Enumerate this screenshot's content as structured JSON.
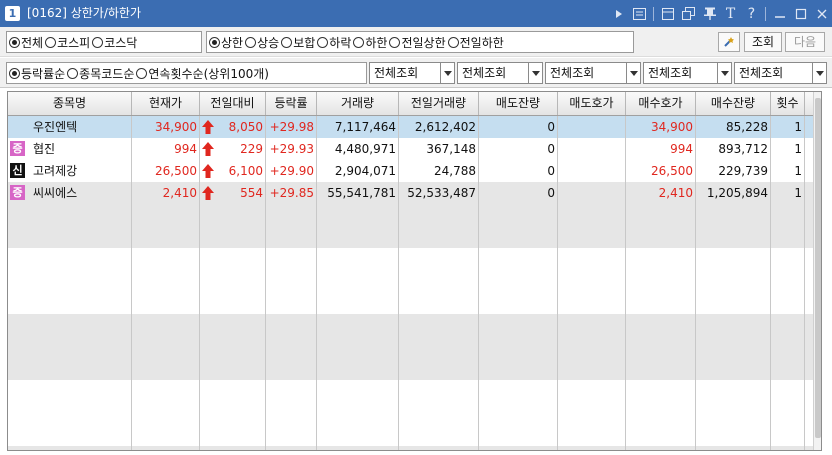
{
  "window": {
    "number": "1",
    "title": "[0162] 상한가/하한가"
  },
  "titlebar_icons": [
    "play-icon",
    "memo-icon",
    "window-icon",
    "popout-icon",
    "pin-icon",
    "font-size-icon",
    "help-icon",
    "minimize-icon",
    "maximize-icon",
    "close-icon"
  ],
  "titlebar_text": {
    "font": "T",
    "help": "?"
  },
  "market_filter": {
    "options": [
      "전체",
      "코스피",
      "코스닥"
    ],
    "selected": "전체"
  },
  "limit_filter": {
    "options": [
      "상한",
      "상승",
      "보합",
      "하락",
      "하한",
      "전일상한",
      "전일하한"
    ],
    "selected": "상한"
  },
  "actions": {
    "search": "조회",
    "next": "다음"
  },
  "sort_filter": {
    "options": [
      "등락률순",
      "종목코드순",
      "연속횟수순(상위100개)"
    ],
    "selected": "등락률순"
  },
  "dropdowns": [
    "전체조회",
    "전체조회",
    "전체조회",
    "전체조회",
    "전체조회"
  ],
  "columns": [
    "종목명",
    "현재가",
    "전일대비",
    "등락률",
    "거래량",
    "전일거래량",
    "매도잔량",
    "매도호가",
    "매수호가",
    "매수잔량",
    "횟수"
  ],
  "rows": [
    {
      "badge": "",
      "badge_color": "",
      "name": "우진엔텍",
      "price": "34,900",
      "change": "8,050",
      "rate": "+29.98",
      "volume": "7,117,464",
      "prev_volume": "2,612,402",
      "ask_qty": "0",
      "ask_price": "",
      "bid_price": "34,900",
      "bid_qty": "85,228",
      "count": "1"
    },
    {
      "badge": "증",
      "badge_color": "#d765c6",
      "name": "협진",
      "price": "994",
      "change": "229",
      "rate": "+29.93",
      "volume": "4,480,971",
      "prev_volume": "367,148",
      "ask_qty": "0",
      "ask_price": "",
      "bid_price": "994",
      "bid_qty": "893,712",
      "count": "1"
    },
    {
      "badge": "신",
      "badge_color": "#111111",
      "name": "고려제강",
      "price": "26,500",
      "change": "6,100",
      "rate": "+29.90",
      "volume": "2,904,071",
      "prev_volume": "24,788",
      "ask_qty": "0",
      "ask_price": "",
      "bid_price": "26,500",
      "bid_qty": "229,739",
      "count": "1"
    },
    {
      "badge": "증",
      "badge_color": "#d765c6",
      "name": "씨씨에스",
      "price": "2,410",
      "change": "554",
      "rate": "+29.85",
      "volume": "55,541,781",
      "prev_volume": "52,533,487",
      "ask_qty": "0",
      "ask_price": "",
      "bid_price": "2,410",
      "bid_qty": "1,205,894",
      "count": "1"
    }
  ],
  "colors": {
    "titlebar": "#3b6db2",
    "up": "#e0271f",
    "selected_row": "#c5def0",
    "band": "#e6e6e6"
  }
}
